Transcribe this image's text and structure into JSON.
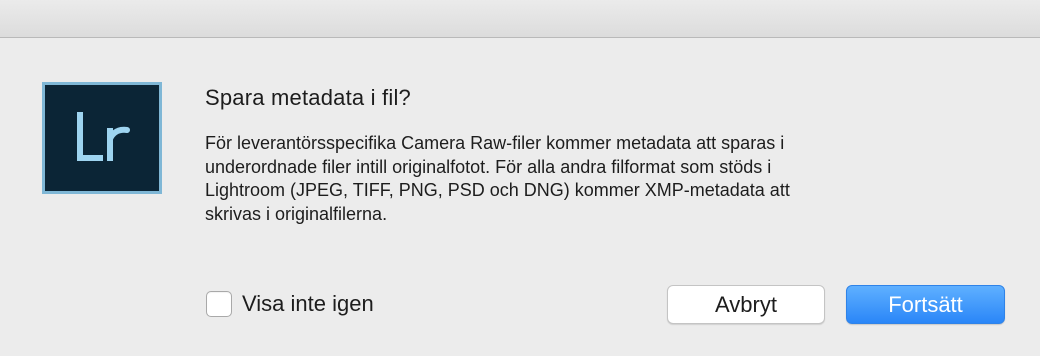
{
  "dialog": {
    "title": "Spara metadata i fil?",
    "message_lines": [
      "För leverantörsspecifika Camera Raw-filer kommer metadata att sparas i",
      "underordnade filer intill originalfotot. För alla andra filformat som stöds i",
      "Lightroom (JPEG, TIFF, PNG, PSD och DNG) kommer XMP-metadata att",
      "skrivas i originalfilerna."
    ],
    "app_icon": {
      "name": "lightroom-app-icon",
      "text": "Lr",
      "background_color": "#0b2536",
      "accent_color": "#7fb7d6"
    },
    "checkbox": {
      "label": "Visa inte igen",
      "checked": false
    },
    "buttons": {
      "cancel_label": "Avbryt",
      "primary_label": "Fortsätt",
      "primary_color": "#2a86f8"
    }
  }
}
